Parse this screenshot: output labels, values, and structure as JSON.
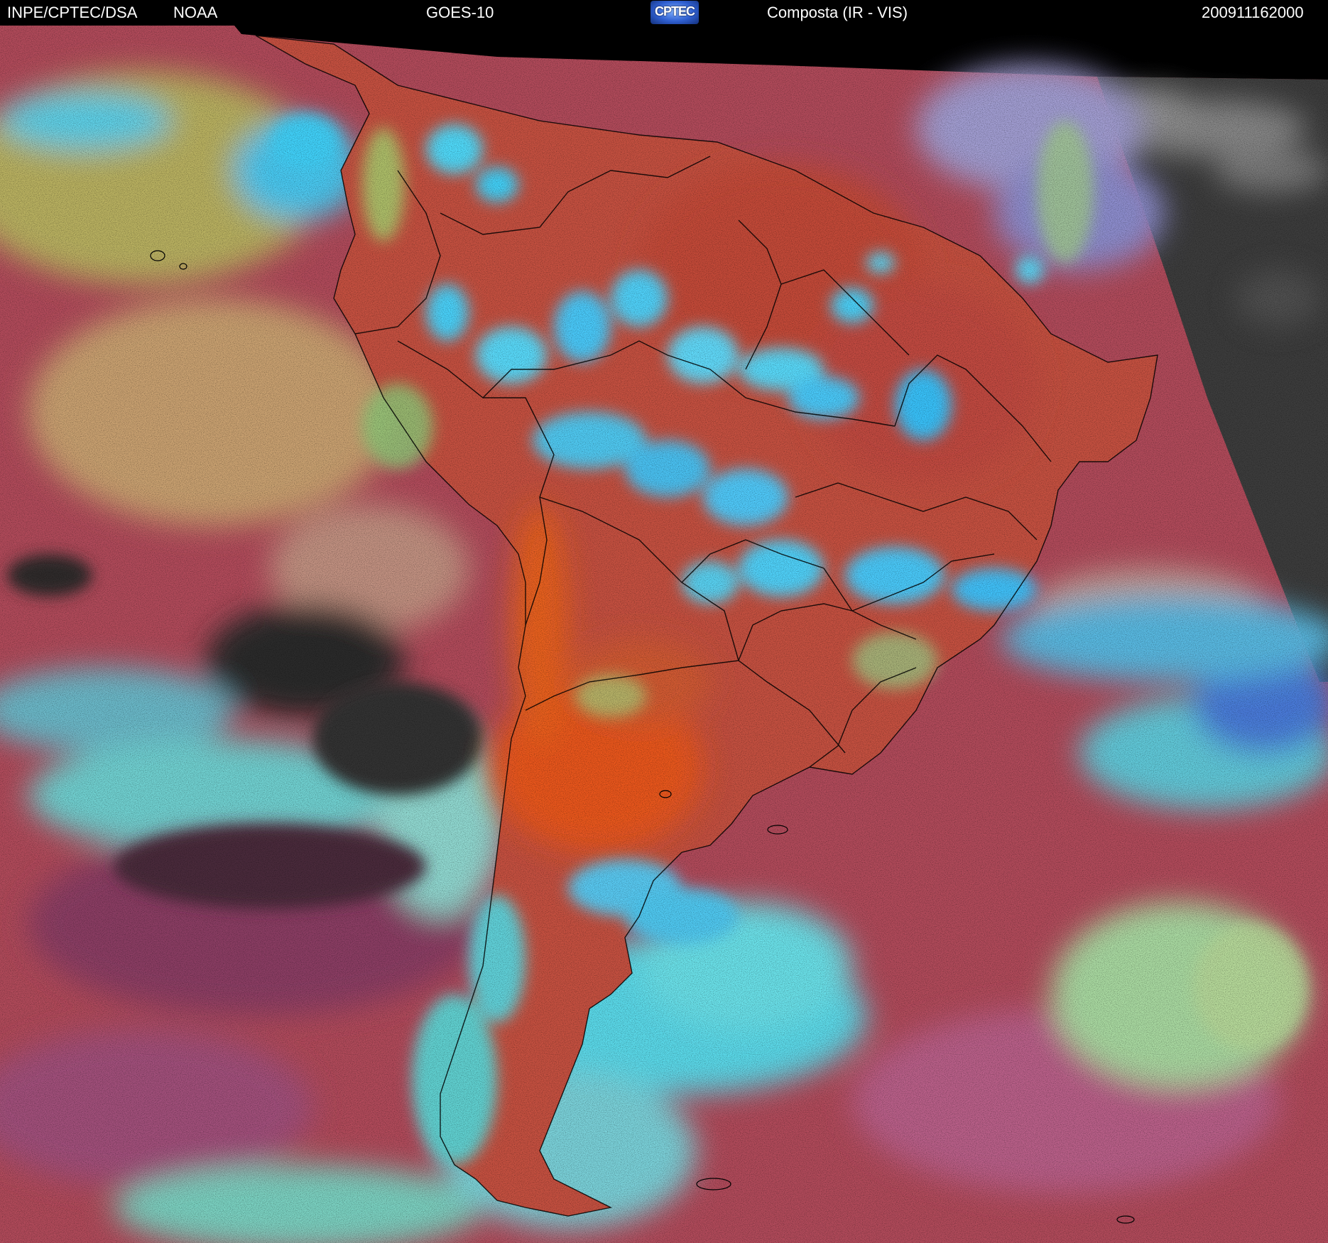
{
  "header": {
    "agency": "INPE/CPTEC/DSA",
    "source": "NOAA",
    "satellite": "GOES-10",
    "logo_text": "CPTEC",
    "product": "Composta (IR - VIS)",
    "timestamp": "200911162000"
  },
  "colors": {
    "ocean_clear": "#b04a5a",
    "land_clear": "#c8503a",
    "argentina_plain": "#e0561e",
    "high_cloud": "#38c8f0",
    "mid_cloud": "#9ad070",
    "blue_cloud": "#4a7ad8",
    "night_sector": "#3a3a3a",
    "dark_ocean": "#2e2a2c",
    "coastline": "#000000"
  }
}
